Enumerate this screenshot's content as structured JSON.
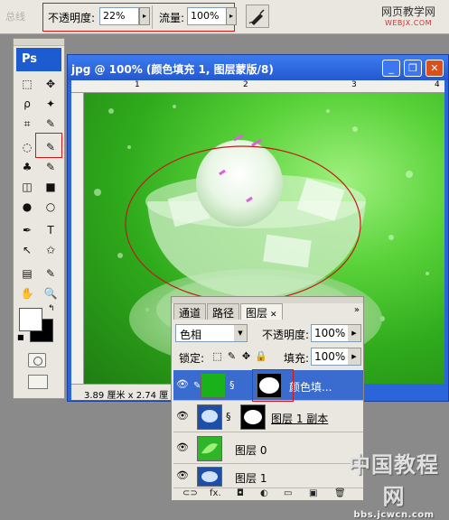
{
  "options_bar": {
    "preset_label": "▾",
    "faded_label": "总线",
    "opacity_label": "不透明度:",
    "opacity_value": "22%",
    "flow_label": "流量:",
    "flow_value": "100%",
    "arrow": "▸"
  },
  "watermark_top": {
    "line1": "网页教学网",
    "line2": "WEBJX.COM"
  },
  "tools": {
    "logo": "Ps",
    "items": [
      "⬚",
      "✥",
      "ρ",
      "✦",
      "⌗",
      "✎",
      "◌",
      "✎",
      "♣",
      "✎",
      "◫",
      "■",
      "●",
      "○",
      "✒",
      "T",
      "↖",
      "✩",
      "▤",
      "✎",
      "✋",
      "🔍"
    ]
  },
  "document": {
    "title": "jpg @ 100% (颜色填充 1, 图层蒙版/8)",
    "minimize": "_",
    "restore": "❐",
    "close": "✕",
    "ruler_ticks": [
      "1",
      "2",
      "3",
      "4"
    ],
    "status": "3.89 厘米 x 2.74 厘"
  },
  "layers_panel": {
    "tabs": [
      "通道",
      "路径",
      "图层"
    ],
    "tab_close": "✕",
    "menu": "»",
    "blend_mode": "色相",
    "opacity_label": "不透明度:",
    "opacity_value": "100%",
    "lock_label": "锁定:",
    "fill_label": "填充:",
    "fill_value": "100%",
    "rows": [
      {
        "name": "颜色填...",
        "selected": true
      },
      {
        "name": "图层 1 副本",
        "selected": false
      },
      {
        "name": "图层 0",
        "selected": false
      },
      {
        "name": "图层 1",
        "selected": false
      }
    ],
    "bottom_icons": [
      "⊂⊃",
      "fx.",
      "◘",
      "◐",
      "▭",
      "▣",
      "🗑"
    ]
  },
  "watermark_bottom": {
    "line1": "中国教程网",
    "line2": "bbs.jcwcn.com"
  }
}
